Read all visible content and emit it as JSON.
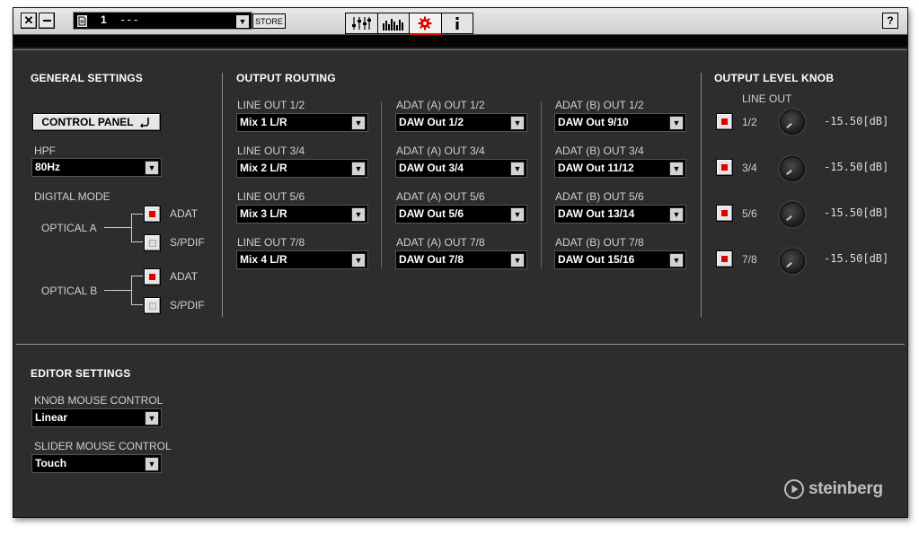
{
  "toolbar": {
    "preset_number": "1",
    "preset_name": "---",
    "store_label": "STORE",
    "help_label": "?"
  },
  "general": {
    "title": "GENERAL SETTINGS",
    "control_panel_label": "CONTROL PANEL",
    "hpf_label": "HPF",
    "hpf_value": "80Hz",
    "digital_mode_label": "DIGITAL MODE",
    "optical_a_label": "OPTICAL A",
    "optical_b_label": "OPTICAL B",
    "adat_label": "ADAT",
    "spdif_label": "S/PDIF",
    "optical_a_mode": "ADAT",
    "optical_b_mode": "ADAT"
  },
  "routing": {
    "title": "OUTPUT ROUTING",
    "line": [
      {
        "label": "LINE OUT 1/2",
        "value": "Mix 1 L/R"
      },
      {
        "label": "LINE OUT 3/4",
        "value": "Mix 2 L/R"
      },
      {
        "label": "LINE OUT 5/6",
        "value": "Mix 3 L/R"
      },
      {
        "label": "LINE OUT 7/8",
        "value": "Mix 4 L/R"
      }
    ],
    "adat_a": [
      {
        "label": "ADAT (A) OUT 1/2",
        "value": "DAW Out 1/2"
      },
      {
        "label": "ADAT (A) OUT 3/4",
        "value": "DAW Out 3/4"
      },
      {
        "label": "ADAT (A) OUT 5/6",
        "value": "DAW Out 5/6"
      },
      {
        "label": "ADAT (A) OUT 7/8",
        "value": "DAW Out 7/8"
      }
    ],
    "adat_b": [
      {
        "label": "ADAT (B) OUT 1/2",
        "value": "DAW Out 9/10"
      },
      {
        "label": "ADAT (B) OUT 3/4",
        "value": "DAW Out 11/12"
      },
      {
        "label": "ADAT (B) OUT 5/6",
        "value": "DAW Out 13/14"
      },
      {
        "label": "ADAT (B) OUT 7/8",
        "value": "DAW Out 15/16"
      }
    ]
  },
  "level_knob": {
    "title": "OUTPUT LEVEL KNOB",
    "subtitle": "LINE OUT",
    "rows": [
      {
        "label": "1/2",
        "value": "-15.50[dB]",
        "enabled": true
      },
      {
        "label": "3/4",
        "value": "-15.50[dB]",
        "enabled": true
      },
      {
        "label": "5/6",
        "value": "-15.50[dB]",
        "enabled": true
      },
      {
        "label": "7/8",
        "value": "-15.50[dB]",
        "enabled": true
      }
    ]
  },
  "editor": {
    "title": "EDITOR SETTINGS",
    "knob_mouse_label": "KNOB MOUSE CONTROL",
    "knob_mouse_value": "Linear",
    "slider_mouse_label": "SLIDER MOUSE CONTROL",
    "slider_mouse_value": "Touch"
  },
  "brand": "steinberg",
  "colors": {
    "panel_bg": "#2d2d2d",
    "checkbox_on": "#e00000",
    "active_tab_icon": "#e00000"
  }
}
